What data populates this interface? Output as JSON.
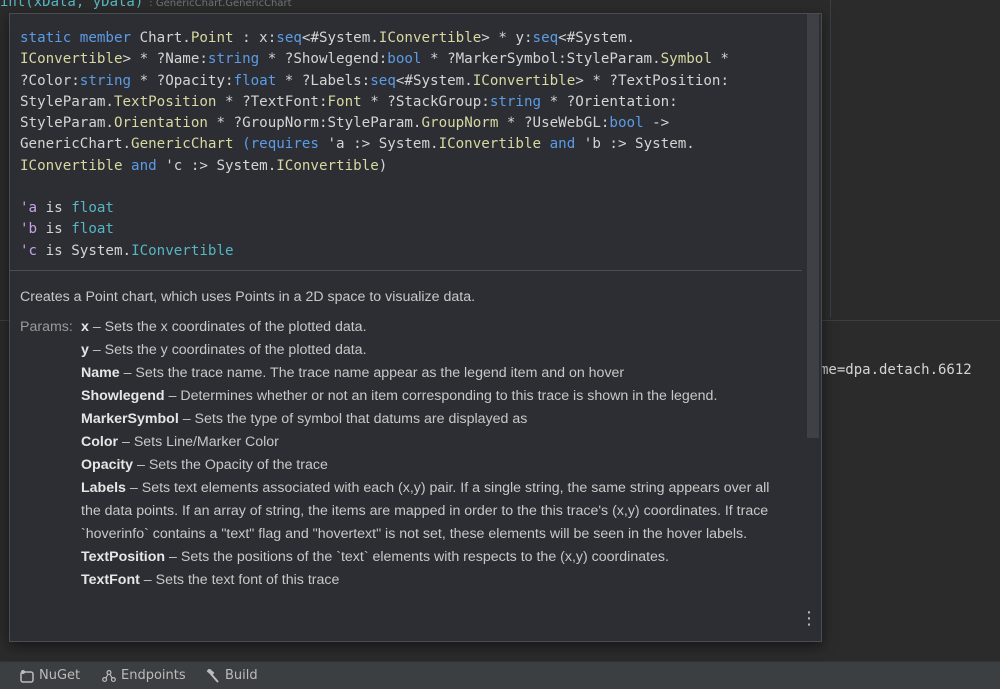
{
  "background_code": {
    "line1_code": "int(xData, yData)",
    "line1_hint": ": GenericChart.GenericChart",
    "console_right": "me=dpa.detach.6612"
  },
  "popup": {
    "signature_lines": [
      [
        [
          "kw",
          "static member "
        ],
        [
          "id",
          "Chart."
        ],
        [
          "ly",
          "Point"
        ],
        [
          "g",
          " : x:"
        ],
        [
          "kw",
          "seq"
        ],
        [
          "g",
          "<#System."
        ],
        [
          "ly",
          "IConvertible"
        ],
        [
          "g",
          "> * y:"
        ],
        [
          "kw",
          "seq"
        ],
        [
          "g",
          "<#System."
        ]
      ],
      [
        [
          "ly",
          "IConvertible"
        ],
        [
          "g",
          "> * ?Name:"
        ],
        [
          "kw",
          "string"
        ],
        [
          "g",
          " * ?Showlegend:"
        ],
        [
          "kw",
          "bool"
        ],
        [
          "g",
          " * ?MarkerSymbol:StyleParam."
        ],
        [
          "ly",
          "Symbol"
        ],
        [
          "g",
          " *"
        ]
      ],
      [
        [
          "g",
          "?Color:"
        ],
        [
          "kw",
          "string"
        ],
        [
          "g",
          " * ?Opacity:"
        ],
        [
          "kw",
          "float"
        ],
        [
          "g",
          " * ?Labels:"
        ],
        [
          "kw",
          "seq"
        ],
        [
          "g",
          "<#System."
        ],
        [
          "ly",
          "IConvertible"
        ],
        [
          "g",
          "> * ?TextPosition:"
        ]
      ],
      [
        [
          "g",
          "StyleParam."
        ],
        [
          "ly",
          "TextPosition"
        ],
        [
          "g",
          " * ?TextFont:"
        ],
        [
          "ly",
          "Font"
        ],
        [
          "g",
          " * ?StackGroup:"
        ],
        [
          "kw",
          "string"
        ],
        [
          "g",
          " * ?Orientation:"
        ]
      ],
      [
        [
          "g",
          "StyleParam."
        ],
        [
          "ly",
          "Orientation"
        ],
        [
          "g",
          " * ?GroupNorm:StyleParam."
        ],
        [
          "ly",
          "GroupNorm"
        ],
        [
          "g",
          " * ?UseWebGL:"
        ],
        [
          "kw",
          "bool"
        ],
        [
          "g",
          " ->"
        ]
      ],
      [
        [
          "g",
          "GenericChart."
        ],
        [
          "ly",
          "GenericChart"
        ],
        [
          "g",
          " "
        ],
        [
          "kw",
          "(requires"
        ],
        [
          "g",
          " 'a :> System."
        ],
        [
          "ly",
          "IConvertible"
        ],
        [
          "g",
          " "
        ],
        [
          "kw",
          "and"
        ],
        [
          "g",
          " 'b :> System."
        ]
      ],
      [
        [
          "ly",
          "IConvertible"
        ],
        [
          "g",
          " "
        ],
        [
          "kw",
          "and"
        ],
        [
          "g",
          " 'c :> System."
        ],
        [
          "ly",
          "IConvertible"
        ],
        [
          "g",
          ")"
        ]
      ]
    ],
    "type_params": [
      {
        "var": "'a",
        "text": " is ",
        "type": "float"
      },
      {
        "var": "'b",
        "text": " is ",
        "type": "float"
      },
      {
        "var": "'c",
        "text": " is System.",
        "type": "IConvertible"
      }
    ],
    "summary": "Creates a Point chart, which uses Points in a 2D space to visualize data.",
    "params_label": "Params:",
    "params": [
      {
        "name": "x",
        "desc": " – Sets the x coordinates of the plotted data."
      },
      {
        "name": "y",
        "desc": " – Sets the y coordinates of the plotted data."
      },
      {
        "name": "Name",
        "desc": " – Sets the trace name. The trace name appear as the legend item and on hover"
      },
      {
        "name": "Showlegend",
        "desc": " – Determines whether or not an item corresponding to this trace is shown in the legend."
      },
      {
        "name": "MarkerSymbol",
        "desc": " – Sets the type of symbol that datums are displayed as"
      },
      {
        "name": "Color",
        "desc": " – Sets Line/Marker Color"
      },
      {
        "name": "Opacity",
        "desc": " – Sets the Opacity of the trace"
      },
      {
        "name": "Labels",
        "desc": " – Sets text elements associated with each (x,y) pair. If a single string, the same string appears over all the data points. If an array of string, the items are mapped in order to the this trace's (x,y) coordinates. If trace `hoverinfo` contains a \"text\" flag and \"hovertext\" is not set, these elements will be seen in the hover labels."
      },
      {
        "name": "TextPosition",
        "desc": " – Sets the positions of the `text` elements with respects to the (x,y) coordinates."
      },
      {
        "name": "TextFont",
        "desc": " – Sets the text font of this trace"
      }
    ],
    "more_icon": "kebab-icon"
  },
  "bottom_bar": {
    "items": [
      {
        "label": "NuGet",
        "icon": "nuget-icon"
      },
      {
        "label": "Endpoints",
        "icon": "endpoints-icon"
      },
      {
        "label": "Build",
        "icon": "hammer-icon"
      }
    ]
  }
}
